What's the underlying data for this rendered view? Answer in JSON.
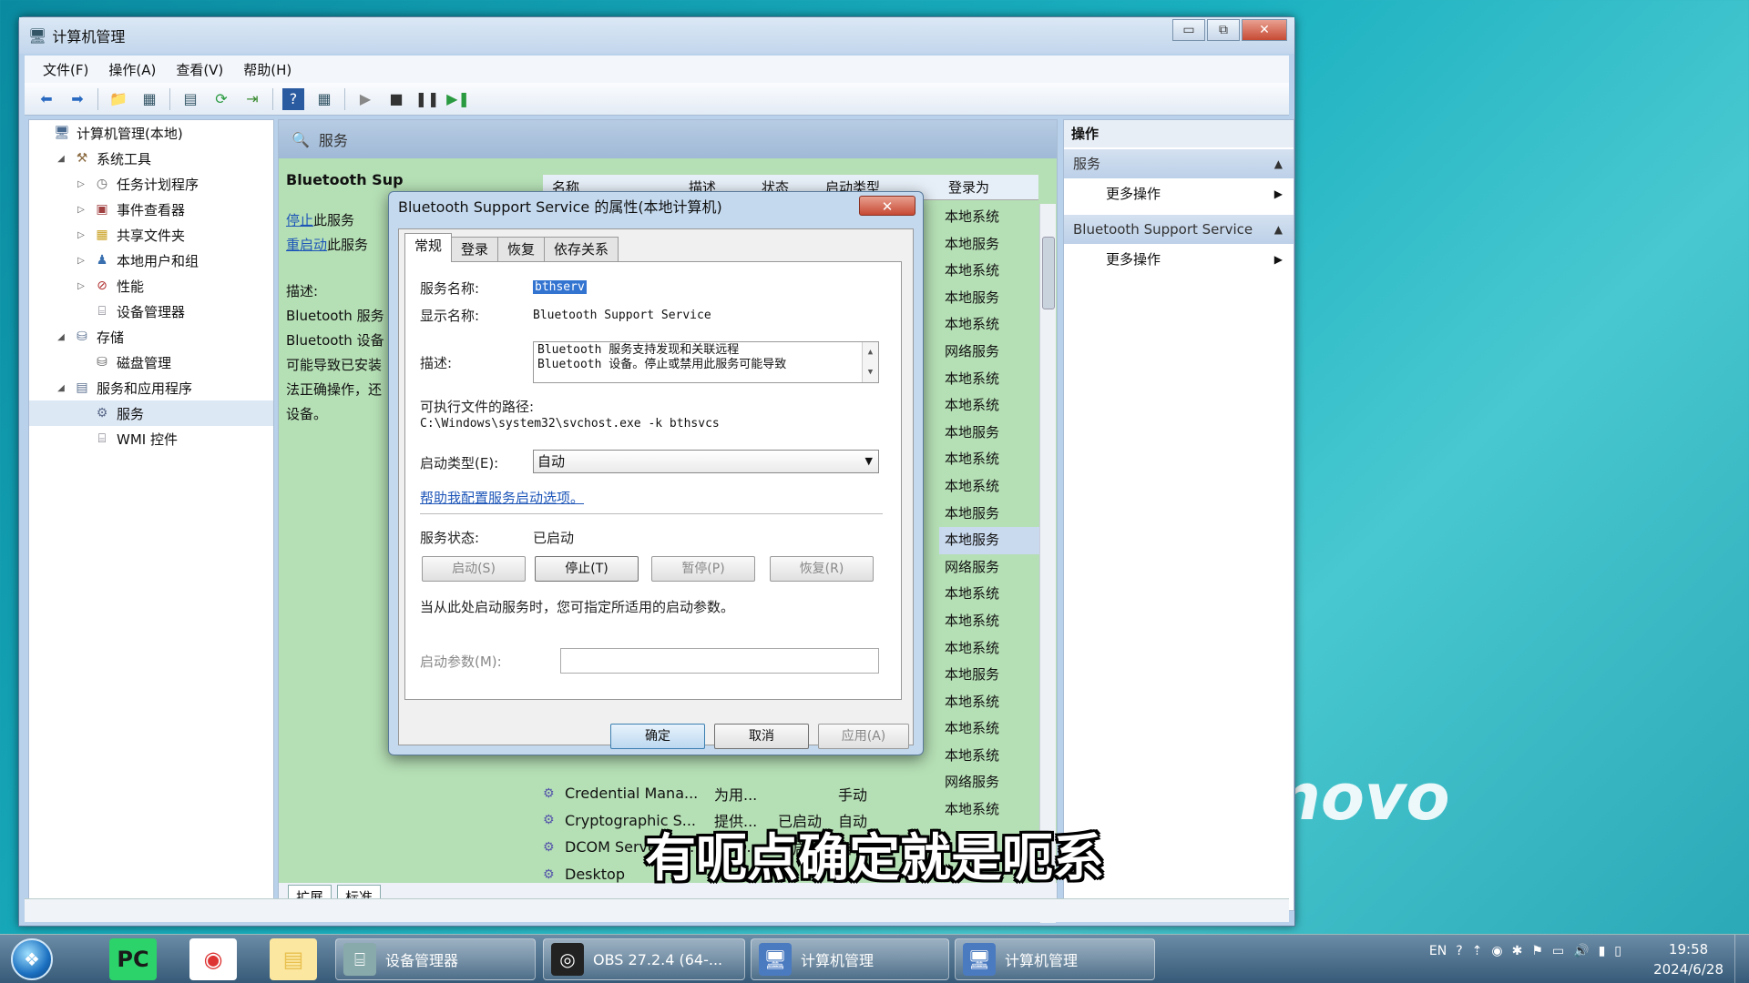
{
  "window": {
    "title": "计算机管理",
    "controls": {
      "minimize": "▭",
      "maximize": "⧉",
      "close": "✕"
    }
  },
  "menu": [
    "文件(F)",
    "操作(A)",
    "查看(V)",
    "帮助(H)"
  ],
  "toolbar_icons": [
    "back-icon",
    "forward-icon",
    "up-folder-icon",
    "show-tree-icon",
    "properties-icon",
    "refresh-icon",
    "export-icon",
    "help-icon",
    "view-icon",
    "play-icon",
    "stop-icon",
    "pause-icon",
    "restart-icon"
  ],
  "tree": [
    {
      "label": "计算机管理(本地)",
      "level": 0,
      "expander": "",
      "icon": "computer-icon"
    },
    {
      "label": "系统工具",
      "level": 1,
      "expander": "◢",
      "icon": "tools-icon"
    },
    {
      "label": "任务计划程序",
      "level": 2,
      "expander": "▷",
      "icon": "clock-icon"
    },
    {
      "label": "事件查看器",
      "level": 2,
      "expander": "▷",
      "icon": "event-viewer-icon"
    },
    {
      "label": "共享文件夹",
      "level": 2,
      "expander": "▷",
      "icon": "shared-folder-icon"
    },
    {
      "label": "本地用户和组",
      "level": 2,
      "expander": "▷",
      "icon": "users-icon"
    },
    {
      "label": "性能",
      "level": 2,
      "expander": "▷",
      "icon": "performance-icon"
    },
    {
      "label": "设备管理器",
      "level": 2,
      "expander": "",
      "icon": "device-manager-icon"
    },
    {
      "label": "存储",
      "level": 1,
      "expander": "◢",
      "icon": "storage-icon"
    },
    {
      "label": "磁盘管理",
      "level": 2,
      "expander": "",
      "icon": "disk-icon"
    },
    {
      "label": "服务和应用程序",
      "level": 1,
      "expander": "◢",
      "icon": "services-apps-icon"
    },
    {
      "label": "服务",
      "level": 2,
      "expander": "",
      "icon": "gear-icon",
      "selected": true
    },
    {
      "label": "WMI 控件",
      "level": 2,
      "expander": "",
      "icon": "wmi-icon"
    }
  ],
  "center": {
    "header": "服务",
    "left": {
      "service_title": "Bluetooth Sup",
      "stop_link": "停止",
      "stop_suffix": "此服务",
      "restart_link": "重启动",
      "restart_suffix": "此服务",
      "desc_label": "描述:",
      "desc_lines": [
        "Bluetooth 服务",
        "Bluetooth 设备",
        "可能导致已安装",
        "法正确操作，还",
        "设备。"
      ]
    },
    "columns": [
      "名称",
      "描述",
      "状态",
      "启动类型",
      "登录为"
    ],
    "logon_col": [
      "本地系统",
      "本地服务",
      "本地系统",
      "本地服务",
      "本地系统",
      "网络服务",
      "本地系统",
      "本地系统",
      "本地服务",
      "本地系统",
      "本地系统",
      "本地服务",
      "本地服务",
      "网络服务",
      "本地系统",
      "本地系统",
      "本地系统",
      "本地服务",
      "本地系统",
      "本地系统",
      "本地系统",
      "网络服务",
      "本地系统"
    ],
    "highlight_index": 12,
    "rows": [
      {
        "name": "Credential Mana...",
        "desc": "为用...",
        "status": "",
        "start": "手动"
      },
      {
        "name": "Cryptographic S...",
        "desc": "提供...",
        "status": "已启动",
        "start": "自动"
      },
      {
        "name": "DCOM Server Pr...",
        "desc": "DCO...",
        "status": "已启动",
        "start": "自动"
      },
      {
        "name": "Desktop",
        "desc": "",
        "status": "",
        "start": ""
      }
    ],
    "tabs": [
      "扩展",
      "标准"
    ]
  },
  "actions": {
    "header": "操作",
    "sections": [
      {
        "title": "服务",
        "item": "更多操作"
      },
      {
        "title": "Bluetooth Support Service",
        "item": "更多操作"
      }
    ]
  },
  "dialog": {
    "title": "Bluetooth Support Service 的属性(本地计算机)",
    "close": "✕",
    "tabs": [
      "常规",
      "登录",
      "恢复",
      "依存关系"
    ],
    "service_name_label": "服务名称:",
    "service_name": "bthserv",
    "display_name_label": "显示名称:",
    "display_name": "Bluetooth Support Service",
    "desc_label": "描述:",
    "desc_line1": "Bluetooth 服务支持发现和关联远程",
    "desc_line2": "Bluetooth 设备。停止或禁用此服务可能导致",
    "path_label": "可执行文件的路径:",
    "path": "C:\\Windows\\system32\\svchost.exe -k bthsvcs",
    "startup_label": "启动类型(E):",
    "startup_value": "自动",
    "help_link": "帮助我配置服务启动选项。",
    "status_label": "服务状态:",
    "status_value": "已启动",
    "btn_start": "启动(S)",
    "btn_stop": "停止(T)",
    "btn_pause": "暂停(P)",
    "btn_resume": "恢复(R)",
    "hint": "当从此处启动服务时，您可指定所适用的启动参数。",
    "param_label": "启动参数(M):",
    "param_value": "",
    "ok": "确定",
    "cancel": "取消",
    "apply": "应用(A)"
  },
  "subtitle": "有呃点确定就是呃系",
  "wallpaper_brand": "novo",
  "taskbar": {
    "start": "❖",
    "pinned": [
      {
        "name": "pycharm-icon",
        "glyph": "PC",
        "color": "#1a1a1a"
      },
      {
        "name": "chrome-icon",
        "glyph": "◉",
        "color": "#d33"
      },
      {
        "name": "explorer-icon",
        "glyph": "▤",
        "color": "#e8c050"
      }
    ],
    "tasks": [
      {
        "label": "设备管理器",
        "icon": "device-manager-icon"
      },
      {
        "label": "OBS 27.2.4 (64-...",
        "icon": "obs-icon"
      },
      {
        "label": "计算机管理",
        "icon": "computer-management-icon"
      },
      {
        "label": "计算机管理",
        "icon": "computer-management-icon"
      }
    ],
    "tray": [
      "EN",
      "?",
      "⇡",
      "◉",
      "✱",
      "⚑",
      "▭",
      "🔊",
      "▮",
      "▯"
    ],
    "time": "19:58",
    "date": "2024/6/28"
  }
}
